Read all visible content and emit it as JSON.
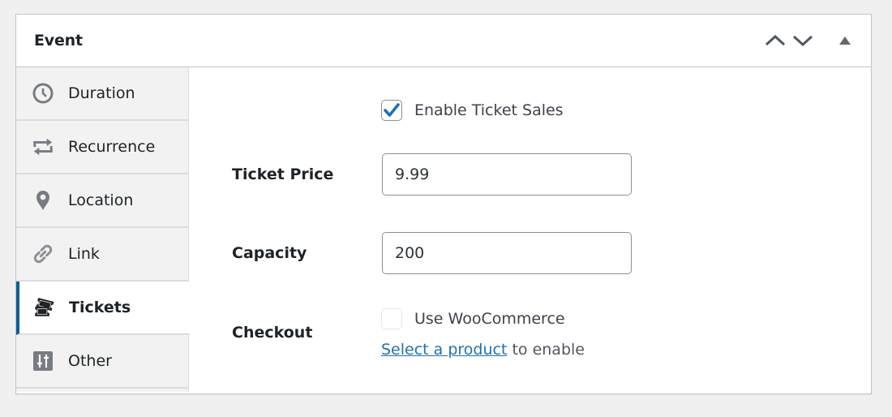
{
  "metabox": {
    "title": "Event",
    "actions": [
      {
        "name": "move-up",
        "icon": "chevron-up-icon"
      },
      {
        "name": "move-down",
        "icon": "chevron-down-icon"
      },
      {
        "name": "toggle-panel",
        "icon": "triangle-up-icon"
      }
    ]
  },
  "tabs": [
    {
      "label": "Duration",
      "icon": "clock-icon",
      "active": false
    },
    {
      "label": "Recurrence",
      "icon": "repeat-icon",
      "active": false
    },
    {
      "label": "Location",
      "icon": "location-pin-icon",
      "active": false
    },
    {
      "label": "Link",
      "icon": "link-icon",
      "active": false
    },
    {
      "label": "Tickets",
      "icon": "tickets-icon",
      "active": true
    },
    {
      "label": "Other",
      "icon": "sliders-icon",
      "active": false
    }
  ],
  "tickets": {
    "enable_sales": {
      "label": "Enable Ticket Sales",
      "checked": true
    },
    "price": {
      "label": "Ticket Price",
      "value": "9.99"
    },
    "capacity": {
      "label": "Capacity",
      "value": "200"
    },
    "checkout": {
      "label": "Checkout",
      "woocommerce": {
        "label": "Use WooCommerce",
        "checked": false
      },
      "helper_link": "Select a product",
      "helper_text": " to enable"
    }
  },
  "colors": {
    "accent": "#135e96",
    "link": "#2271b1",
    "checkmark": "#2271b1",
    "icon_gray": "#787c82"
  }
}
